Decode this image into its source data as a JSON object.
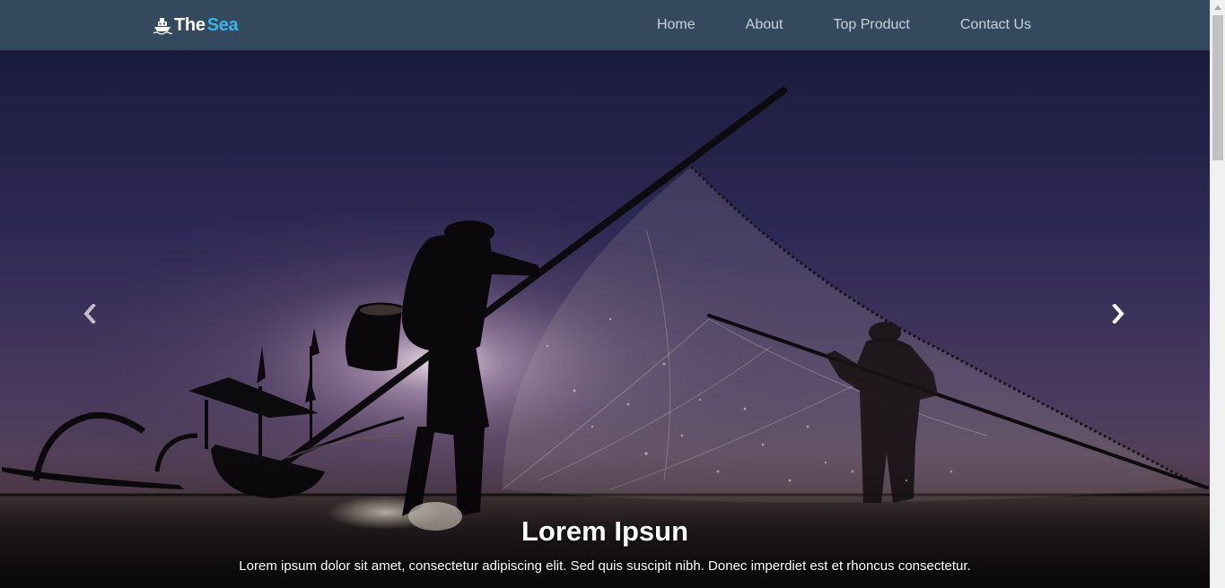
{
  "brand": {
    "part1": "The",
    "part2": "Sea"
  },
  "nav": {
    "items": [
      {
        "label": "Home"
      },
      {
        "label": "About"
      },
      {
        "label": "Top Product"
      },
      {
        "label": "Contact Us"
      }
    ]
  },
  "carousel": {
    "caption_title": "Lorem Ipsun",
    "caption_text": "Lorem ipsum dolor sit amet, consectetur adipiscing elit. Sed quis suscipit nibh. Donec imperdiet est et rhoncus consectetur.",
    "prev_icon": "chevron-left-icon",
    "next_icon": "chevron-right-icon"
  },
  "colors": {
    "navbar_bg": "#34495e",
    "brand_accent": "#3bb4e5",
    "nav_text": "#c9d2db"
  }
}
